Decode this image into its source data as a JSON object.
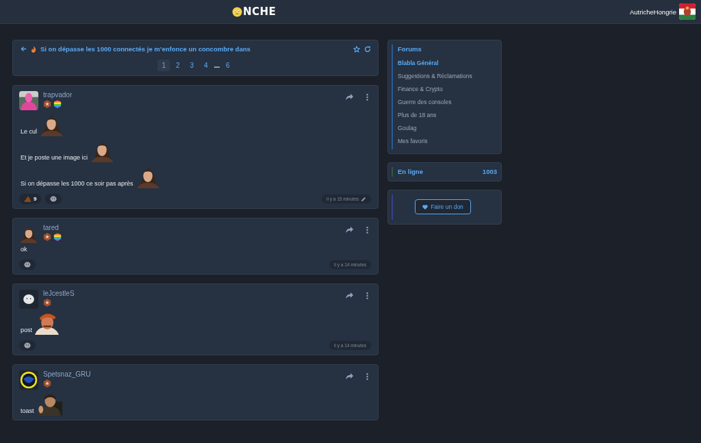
{
  "header": {
    "logo_text": "NCHE",
    "username": "AutricheHongrie"
  },
  "topic": {
    "title": "Si on dépasse les 1000 connectés je m’enfonce un concombre dans",
    "hot": true,
    "pages": [
      {
        "label": "1",
        "selected": true
      },
      {
        "label": "2",
        "selected": false
      },
      {
        "label": "3",
        "selected": false
      },
      {
        "label": "4",
        "selected": false
      },
      {
        "label": "...",
        "kind": "ellipsis"
      },
      {
        "label": "6",
        "selected": false
      }
    ]
  },
  "posts": [
    {
      "author": "trapvador",
      "avatar": {
        "kind": "picture"
      },
      "badges": [
        {
          "kind": "star"
        },
        {
          "kind": "rainbow"
        }
      ],
      "lines": [
        {
          "text": "Le cul",
          "image": {
            "kind": "picture"
          }
        },
        {
          "text": "Et je poste une image ici",
          "image": {
            "kind": "picture"
          }
        },
        {
          "text": "Si on dépasse les 1000 ce soir pas après",
          "image": {
            "kind": "picture"
          }
        }
      ],
      "reactions": [
        {
          "kind": "poop",
          "count": "9"
        },
        {
          "kind": "add"
        }
      ],
      "time": "il y a 15 minutes",
      "edited": true
    },
    {
      "author": "tared",
      "avatar": {
        "kind": "picture"
      },
      "badges": [
        {
          "kind": "star"
        },
        {
          "kind": "rainbow"
        }
      ],
      "lines": [
        {
          "text": "ok"
        }
      ],
      "reactions": [
        {
          "kind": "add"
        }
      ],
      "time": "il y a 14 minutes",
      "edited": false
    },
    {
      "author": "leJcestleS",
      "avatar": {
        "kind": "picture"
      },
      "badges": [
        {
          "kind": "star"
        }
      ],
      "lines": [
        {
          "text": "post",
          "image": {
            "kind": "picture"
          }
        }
      ],
      "reactions": [
        {
          "kind": "add"
        }
      ],
      "time": "il y a 14 minutes",
      "edited": false
    },
    {
      "author": "Spetsnaz_GRU",
      "avatar": {
        "kind": "picture"
      },
      "badges": [
        {
          "kind": "star"
        }
      ],
      "lines": [
        {
          "text": "toast",
          "image": {
            "kind": "picture"
          }
        }
      ]
    }
  ],
  "sidebar": {
    "forums_title": "Forums",
    "forums": [
      {
        "label": "Blabla Général",
        "selected": true
      },
      {
        "label": "Suggestions & Réclamations",
        "selected": false
      },
      {
        "label": "Finance & Crypto",
        "selected": false
      },
      {
        "label": "Guerre des consoles",
        "selected": false
      },
      {
        "label": "Plus de 18 ans",
        "selected": false
      },
      {
        "label": "Goulag",
        "selected": false
      },
      {
        "label": "Mes favoris",
        "selected": false
      }
    ],
    "online_label": "En ligne",
    "online_count": "1003",
    "donate_label": "Faire un don"
  }
}
